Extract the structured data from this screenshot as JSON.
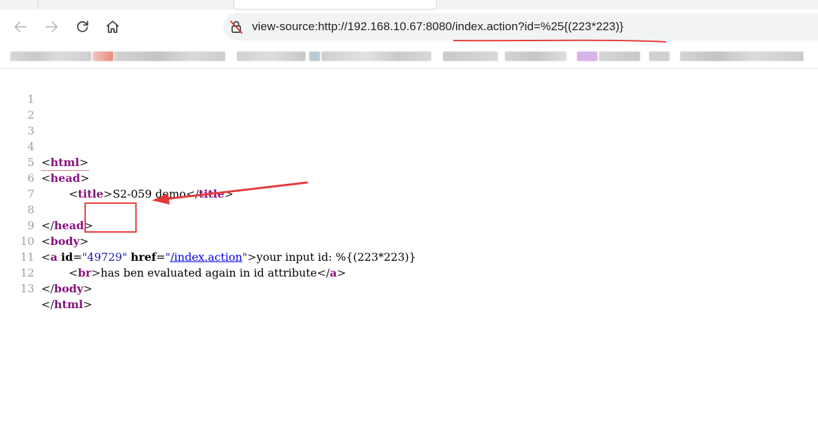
{
  "browser": {
    "address_bar": {
      "url": "view-source:http://192.168.10.67:8080/index.action?id=%25{(223*223)}"
    },
    "icons": {
      "back": "arrow-left-icon",
      "forward": "arrow-right-icon",
      "reload": "reload-icon",
      "home": "home-icon",
      "not_secure": "not-secure-lock-icon"
    }
  },
  "source": {
    "line_numbers": [
      "1",
      "2",
      "3",
      "4",
      "5",
      "6",
      "7",
      "8",
      "9",
      "10",
      "11",
      "12",
      "13"
    ],
    "tags": {
      "html": "html",
      "head": "head",
      "title": "title",
      "body": "body",
      "a": "a",
      "br": "br"
    },
    "title_text": "S2-059 demo",
    "anchor": {
      "id_attr": "id",
      "id_value": "49729",
      "href_attr": "href",
      "href_value": "/index.action",
      "text": "your input id: %{(223*223)}"
    },
    "line11_text": "has ben evaluated again in id attribute"
  },
  "colors": {
    "annotation": "#e43a3a",
    "tag": "#881280",
    "link": "#0000ee"
  }
}
